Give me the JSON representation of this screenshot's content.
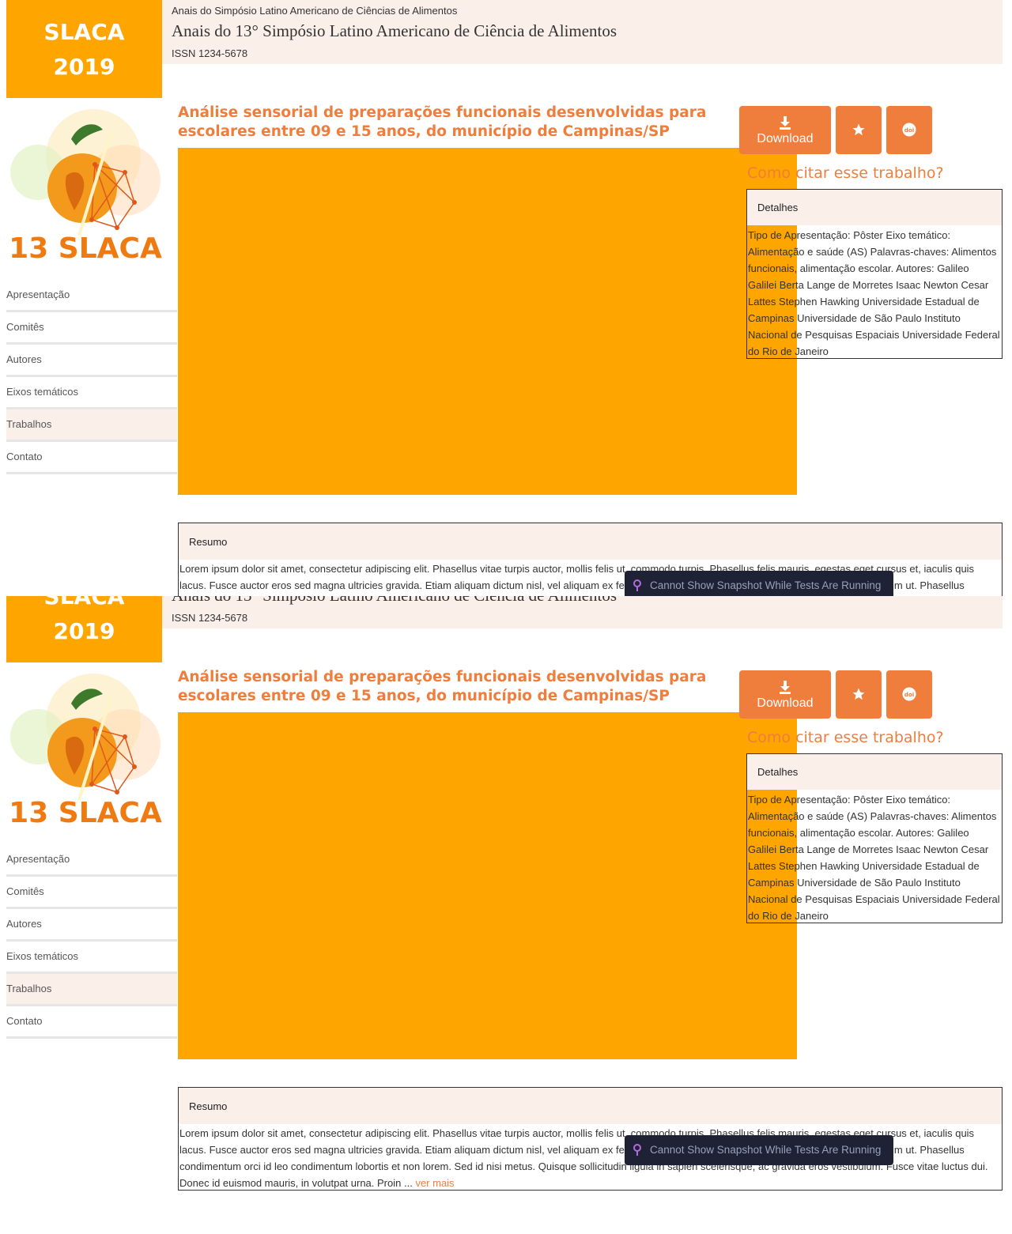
{
  "logo": {
    "line1": "SLACA",
    "line2": "2019",
    "graphic_text": "13 SLACA"
  },
  "header": {
    "subtitle": "Anais do Simpósio Latino Americano de Ciências de Alimentos",
    "title": "Anais do 13° Simpósio Latino Americano de Ciência de Alimentos",
    "issn": "ISSN 1234-5678"
  },
  "nav": {
    "items": [
      {
        "label": "Apresentação"
      },
      {
        "label": "Comitês"
      },
      {
        "label": "Autores"
      },
      {
        "label": "Eixos temáticos"
      },
      {
        "label": "Trabalhos",
        "active": true
      },
      {
        "label": "Contato"
      }
    ]
  },
  "article": {
    "title": "Análise sensorial de preparações funcionais desenvolvidas para escolares entre 09 e 15 anos, do município de Campinas/SP"
  },
  "actions": {
    "download_label": "Download",
    "download_icon": "download-icon",
    "favorite_icon": "star-icon",
    "doi_icon": "doi-icon",
    "cite_heading": "Como citar esse trabalho?"
  },
  "details": {
    "header": "Detalhes",
    "body": "Tipo de Apresentação: Pôster Eixo temático: Alimentação e saúde (AS) Palavras-chaves: Alimentos funcionais, alimentação escolar. Autores: Galileo Galilei Berta Lange de Morretes Isaac Newton Cesar Lattes Stephen Hawking Universidade Estadual de Campinas Universidade de São Paulo Instituto Nacional de Pesquisas Espaciais Universidade Federal do Rio de Janeiro"
  },
  "resumo": {
    "header": "Resumo",
    "body": "Lorem ipsum dolor sit amet, consectetur adipiscing elit. Phasellus vitae turpis auctor, mollis felis ut, commodo turpis. Phasellus felis mauris, egestas eget cursus et, iaculis quis lacus. Fusce auctor eros sed magna ultricies gravida. Etiam aliquam dictum nisl, vel aliquam ex fermentum sed. Sed consequat nisl at viverra lorem vestibulum ut. Phasellus condimentum orci id leo condimentum lobortis et non lorem. Sed id nisi metus. Quisque sollicitudin ligula in sapien scelerisque, ac gravida eros vestibulum. Fusce vitae luctus dui. Donec id euismod mauris, in volutpat urna. Proin ...",
    "more_label": "ver mais"
  },
  "toast": {
    "message": "Cannot Show Snapshot While Tests Are Running",
    "icon": "pin-icon"
  },
  "colors": {
    "orange": "#ffa500",
    "accent": "#ef7d3c",
    "header_bg": "#fbefea",
    "toast_bg": "#1e2234"
  }
}
